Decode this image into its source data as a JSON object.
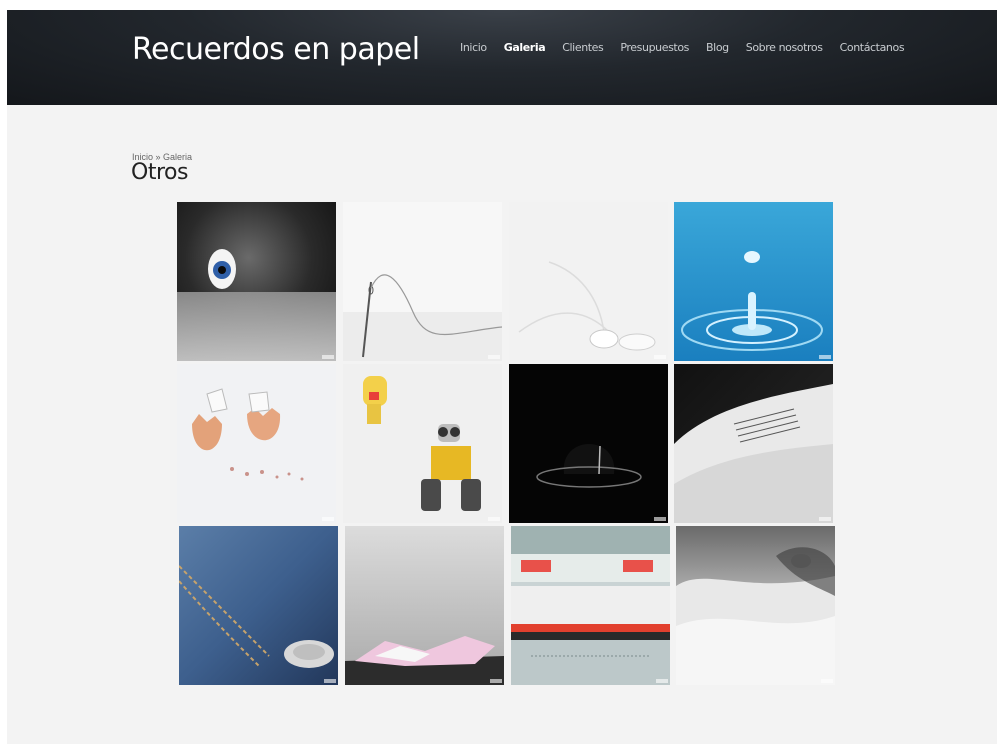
{
  "site": {
    "title": "Recuerdos en papel"
  },
  "nav": [
    {
      "label": "Inicio",
      "active": false
    },
    {
      "label": "Galeria",
      "active": true
    },
    {
      "label": "Clientes",
      "active": false
    },
    {
      "label": "Presupuestos",
      "active": false
    },
    {
      "label": "Blog",
      "active": false
    },
    {
      "label": "Sobre nosotros",
      "active": false
    },
    {
      "label": "Contáctanos",
      "active": false
    }
  ],
  "breadcrumb": {
    "home": "Inicio",
    "separator": " » ",
    "current": "Galeria"
  },
  "page": {
    "title": "Otros"
  },
  "gallery": [
    {
      "subject": "eye-photo"
    },
    {
      "subject": "needle-thread-photo"
    },
    {
      "subject": "earphones-photo"
    },
    {
      "subject": "water-drop-photo"
    },
    {
      "subject": "eggshell-photo"
    },
    {
      "subject": "wall-e-toy-photo"
    },
    {
      "subject": "dark-lamp-photo"
    },
    {
      "subject": "open-book-photo"
    },
    {
      "subject": "jeans-photo"
    },
    {
      "subject": "sky-paper-photo"
    },
    {
      "subject": "subway-train-photo"
    },
    {
      "subject": "snow-animal-photo"
    }
  ],
  "colors": {
    "header": "#1a1e23",
    "background": "#f3f3f3",
    "nav_text": "#c8ccd0"
  }
}
